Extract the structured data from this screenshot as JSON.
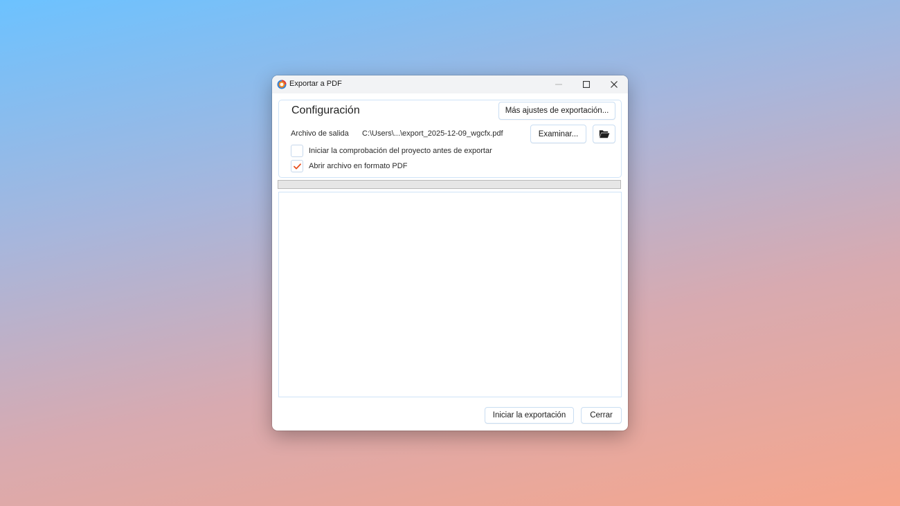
{
  "window": {
    "title": "Exportar a PDF",
    "icon": "app-logo-icon"
  },
  "config": {
    "section_title": "Configuración",
    "more_settings_label": "Más ajustes de exportación...",
    "output_label": "Archivo de salida",
    "output_path": "C:\\Users\\...\\export_2025-12-09_wgcfx.pdf",
    "browse_label": "Examinar...",
    "folder_icon": "open-folder-icon",
    "options": [
      {
        "label": "Iniciar la comprobación del proyecto antes de exportar",
        "checked": false
      },
      {
        "label": "Abrir archivo en formato PDF",
        "checked": true
      }
    ]
  },
  "progress": {
    "value": 0
  },
  "footer": {
    "start_label": "Iniciar la exportación",
    "close_label": "Cerrar"
  },
  "colors": {
    "check_accent": "#e8501f",
    "border_accent": "#cfe3f7"
  }
}
